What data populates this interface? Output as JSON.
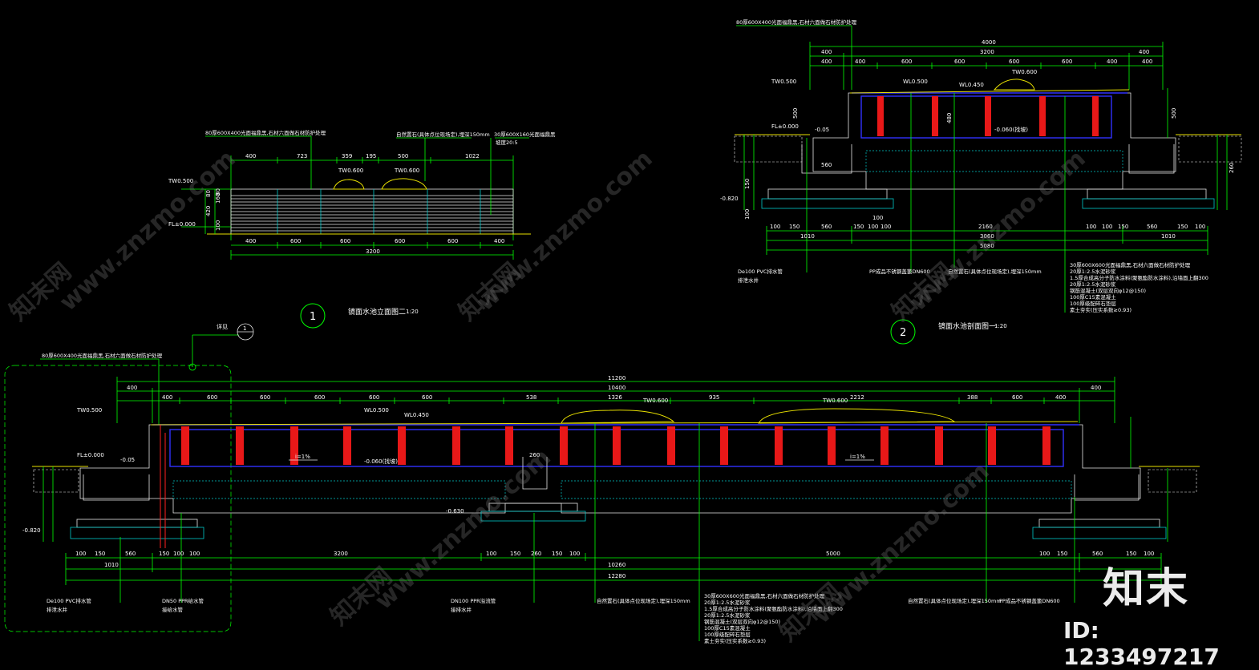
{
  "drawing": {
    "section1": {
      "number": "1",
      "title": "镜面水池立面图二",
      "scale": "1:20",
      "top_dims": [
        "400",
        "723",
        "359",
        "195",
        "500",
        "1022"
      ],
      "bottom_dims": [
        "400",
        "600",
        "600",
        "600",
        "600",
        "400"
      ],
      "total": "3200",
      "side_dims": [
        "80",
        "420",
        "160",
        "100",
        "80"
      ],
      "tw": "TW0.500",
      "fl": "FL±0.000",
      "marks": [
        "TW0.600",
        "TW0.600"
      ],
      "notes": [
        "80厚600X400光面福鼎黑,石材六面做石材防护处理",
        "自然置石(具体点位现场定),埋深150mm",
        "30厚600X160光面福鼎黑",
        "坡度20:5"
      ]
    },
    "section2": {
      "number": "2",
      "title": "镜面水池剖面图一",
      "scale": "1:20",
      "top_note": "80厚600X400光面福鼎黑,石材六面做石材防护处理",
      "dims_row1": [
        "4000"
      ],
      "dims_row2": [
        "400",
        "3200",
        "400"
      ],
      "dims_row3": [
        "400",
        "400",
        "600",
        "600",
        "600",
        "600",
        "400",
        "400"
      ],
      "labels": [
        "TW0.500",
        "WL0.500",
        "WL0.450",
        "TW0.600",
        "FL±0.000",
        "-0.05",
        "-0.060(找坡)",
        "-0.820"
      ],
      "side_dims": [
        "500",
        "480",
        "560",
        "500",
        "260",
        "100",
        "150",
        "100"
      ],
      "bottom_dims": [
        "100",
        "150",
        "560",
        "150",
        "100",
        "100",
        "2160",
        "100",
        "100",
        "150",
        "560",
        "150",
        "100"
      ],
      "bottom_totals": [
        "1010",
        "3060",
        "1010",
        "5080"
      ],
      "callouts": [
        "De100 PVC排水管",
        "排泄水井",
        "PP成品不锈钢盖篦DN600",
        "自然置石(具体点位现场定),埋深150mm"
      ],
      "layers": [
        "30厚600X600光面福鼎黑,石材六面做石材防护处理",
        "20厚1:2.5水泥砂浆",
        "1.5厚合成高分子防水涂料(聚氨酯防水涂料),沿墙面上翻300",
        "20厚1:2.5水泥砂浆",
        "钢筋混凝土(双层双向φ12@150)",
        "100厚C15素混凝土",
        "100厚级配碎石垫层",
        "素土夯实(压实系数≥0.93)"
      ]
    },
    "section3": {
      "callout_mark": "详见",
      "callout_num": "1",
      "top_note": "80厚600X400光面福鼎黑,石材六面做石材防护处理",
      "total": "11200",
      "total2": "10400",
      "top_dims": [
        "400",
        "400",
        "600",
        "600",
        "600",
        "600",
        "600",
        "538",
        "1326",
        "935",
        "2212",
        "388",
        "600",
        "400",
        "400"
      ],
      "labels": [
        "TW0.500",
        "WL0.500",
        "WL0.450",
        "TW0.600",
        "TW0.600",
        "FL±0.000",
        "-0.05",
        "-0.060(找坡)",
        "-0.820",
        "-0.630",
        "260",
        "i=1%",
        "i=1%"
      ],
      "bottom_dims": [
        "100",
        "150",
        "560",
        "150",
        "100",
        "100",
        "3200",
        "100",
        "150",
        "260",
        "150",
        "100",
        "5000",
        "100",
        "150",
        "560",
        "150",
        "100"
      ],
      "bottom_totals": [
        "1010",
        "10260",
        "12280"
      ],
      "callouts": [
        "De100 PVC排水管",
        "排泄水井",
        "DN50 PPR给水管",
        "接给水管",
        "DN100 PPR溢流管",
        "接排水井",
        "自然置石(具体点位现场定),埋深150mm",
        "自然置石(具体点位现场定),埋深150mm",
        "PP成品不锈钢盖篦DN600"
      ],
      "layers": [
        "30厚600X600光面福鼎黑,石材六面做石材防护处理",
        "20厚1:2.5水泥砂浆",
        "1.5厚合成高分子防水涂料(聚氨酯防水涂料),沿墙面上翻300",
        "20厚1:2.5水泥砂浆",
        "钢筋混凝土(双层双向φ12@150)",
        "100厚C15素混凝土",
        "100厚级配碎石垫层",
        "素土夯实(压实系数≥0.93)"
      ]
    }
  },
  "watermark": {
    "logo_text": "知末",
    "id_label": "ID: 1233497217",
    "url": "www.znzmo.com",
    "cn": "知末网"
  },
  "colors": {
    "background": "#000000",
    "dimension": "#00ff00",
    "structure": "#e6e6e6",
    "water": "#3030ff",
    "stone": "#e8e000",
    "post": "#ff2020",
    "soil": "#00c8c8"
  }
}
